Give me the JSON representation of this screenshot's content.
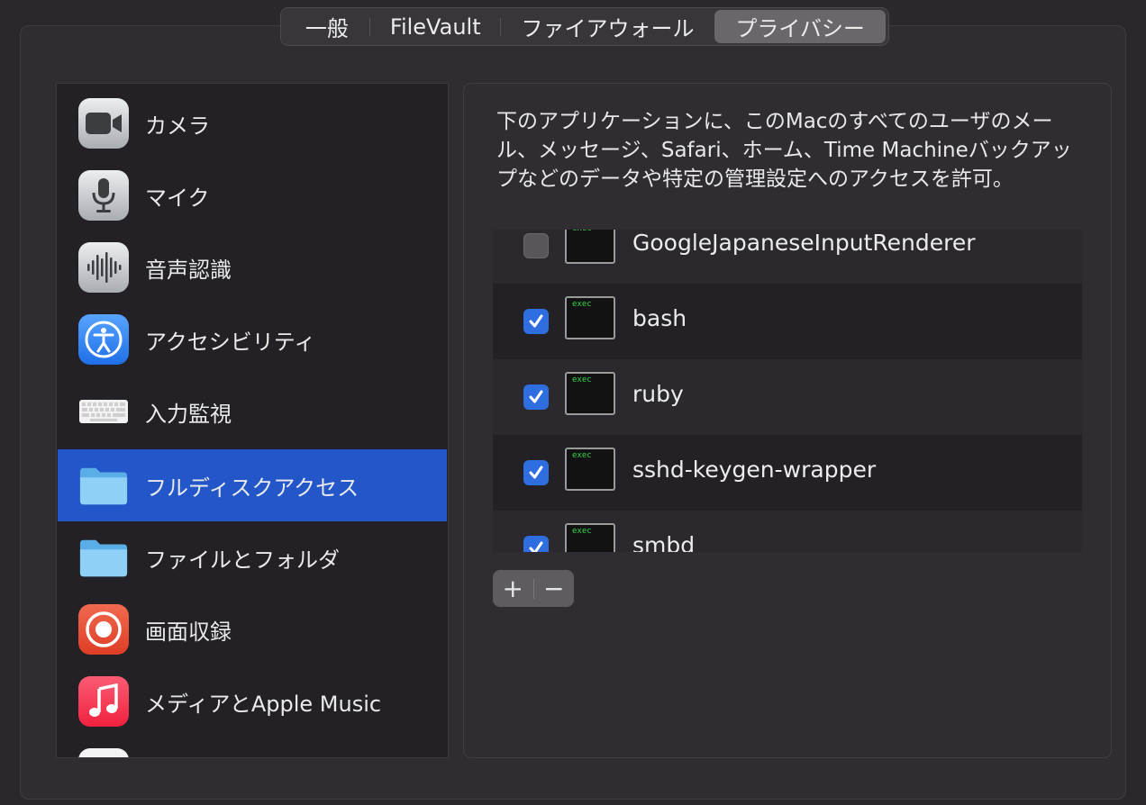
{
  "tabs": [
    {
      "label": "一般"
    },
    {
      "label": "FileVault"
    },
    {
      "label": "ファイアウォール"
    },
    {
      "label": "プライバシー",
      "active": true
    }
  ],
  "sidebar": {
    "items": [
      {
        "label": "カメラ",
        "icon": "camera-icon"
      },
      {
        "label": "マイク",
        "icon": "microphone-icon"
      },
      {
        "label": "音声認識",
        "icon": "waveform-icon"
      },
      {
        "label": "アクセシビリティ",
        "icon": "accessibility-icon"
      },
      {
        "label": "入力監視",
        "icon": "keyboard-icon"
      },
      {
        "label": "フルディスクアクセス",
        "icon": "folder-icon",
        "selected": true
      },
      {
        "label": "ファイルとフォルダ",
        "icon": "folder-icon"
      },
      {
        "label": "画面収録",
        "icon": "screen-recording-icon"
      },
      {
        "label": "メディアとApple Music",
        "icon": "music-icon"
      }
    ]
  },
  "main": {
    "description": "下のアプリケーションに、このMacのすべてのユーザのメール、メッセージ、Safari、ホーム、Time Machineバックアップなどのデータや特定の管理設定へのアクセスを許可。",
    "apps": [
      {
        "name": "GoogleJapaneseInputRenderer",
        "checked": false
      },
      {
        "name": "bash",
        "checked": true
      },
      {
        "name": "ruby",
        "checked": true
      },
      {
        "name": "sshd-keygen-wrapper",
        "checked": true
      },
      {
        "name": "smbd",
        "checked": true
      }
    ],
    "exec_label": "exec",
    "add_label": "+",
    "remove_label": "−"
  },
  "colors": {
    "accent": "#2357c9",
    "checkbox": "#2f6ee0",
    "background": "#2a282b"
  }
}
